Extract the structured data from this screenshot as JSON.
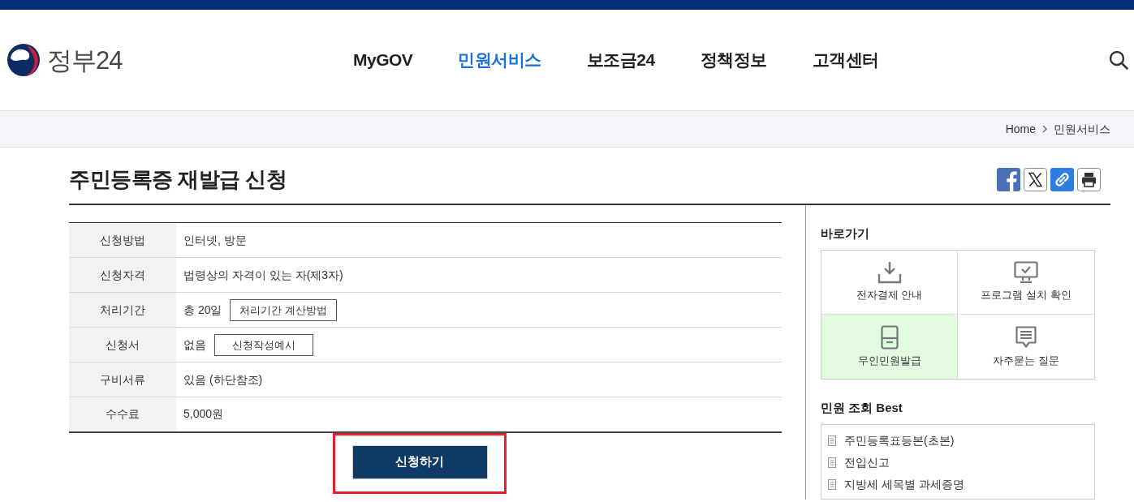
{
  "header": {
    "logo_text": "정부24",
    "nav": [
      {
        "label": "MyGOV",
        "selected": false
      },
      {
        "label": "민원서비스",
        "selected": true
      },
      {
        "label": "보조금24",
        "selected": false
      },
      {
        "label": "정책정보",
        "selected": false
      },
      {
        "label": "고객센터",
        "selected": false
      }
    ]
  },
  "breadcrumb": [
    "Home",
    "민원서비스"
  ],
  "page_title": "주민등록증 재발급 신청",
  "info_table": [
    {
      "label": "신청방법",
      "value": "인터넷, 방문"
    },
    {
      "label": "신청자격",
      "value": "법령상의 자격이 있는 자(제3자)"
    },
    {
      "label": "처리기간",
      "value": "총 20일",
      "button": "처리기간 계산방법"
    },
    {
      "label": "신청서",
      "value": "없음",
      "button": "신청작성예시"
    },
    {
      "label": "구비서류",
      "value": "있음 (하단참조)"
    },
    {
      "label": "수수료",
      "value": "5,000원"
    }
  ],
  "apply_button": {
    "label": "신청하기",
    "highlighted": true
  },
  "quick_links": {
    "title": "바로가기",
    "items": [
      {
        "label": "전자결제 안내",
        "selected": false
      },
      {
        "label": "프로그램 설치 확인",
        "selected": false
      },
      {
        "label": "무인민원발급",
        "selected": true
      },
      {
        "label": "자주묻는 질문",
        "selected": false
      }
    ]
  },
  "best_services": {
    "title": "민원 조회 Best",
    "items": [
      "주민등록표등본(초본)",
      "전입신고",
      "지방세 세목별 과세증명"
    ]
  }
}
